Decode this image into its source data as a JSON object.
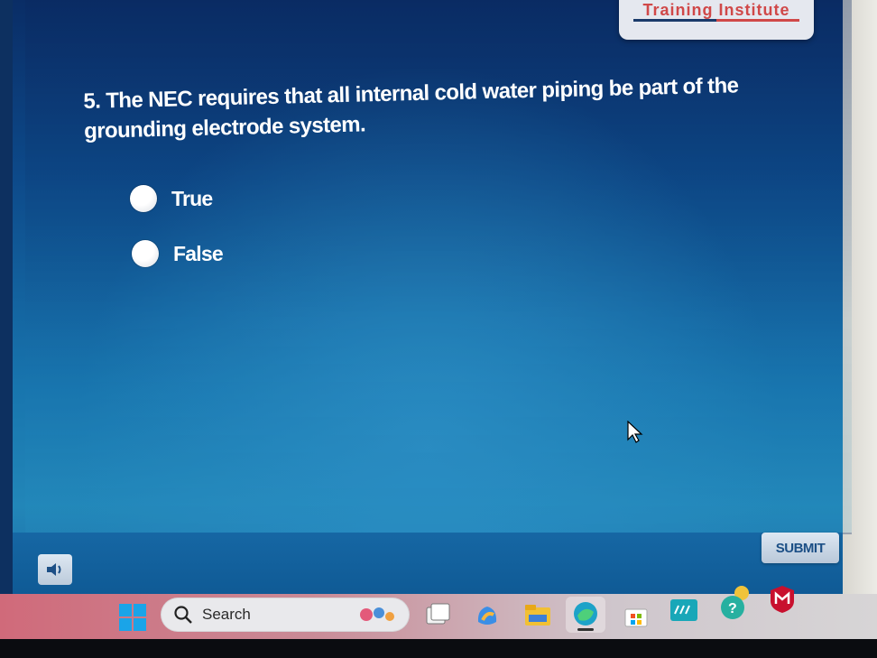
{
  "brand": {
    "name": "Training Institute"
  },
  "question": {
    "text": "5. The NEC requires that all internal cold water piping be part of the grounding electrode system."
  },
  "options": [
    {
      "label": "True"
    },
    {
      "label": "False"
    }
  ],
  "player": {
    "submit_label": "SUBMIT",
    "audio_icon": "speaker-icon"
  },
  "taskbar": {
    "search_label": "Search",
    "icons": [
      "windows-start-icon",
      "search-icon",
      "task-view-icon",
      "copilot-icon",
      "file-explorer-icon",
      "edge-icon",
      "store-icon",
      "hp-icon",
      "help-icon",
      "mcafee-icon"
    ]
  },
  "colors": {
    "accent": "#d04848",
    "slide_bg": "#1875ae",
    "submit_text": "#1c4f86"
  }
}
